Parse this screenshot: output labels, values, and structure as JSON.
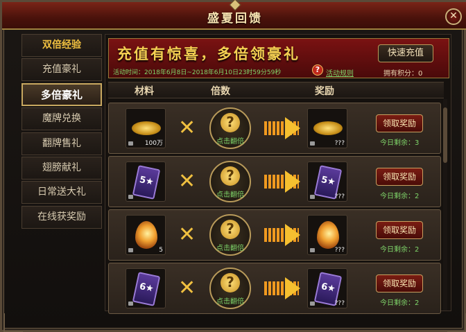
{
  "window": {
    "title": "盛夏回馈",
    "close_glyph": "✕"
  },
  "sidebar": {
    "items": [
      {
        "label": "双倍经验",
        "style": "gold"
      },
      {
        "label": "充值豪礼",
        "style": "normal"
      },
      {
        "label": "多倍豪礼",
        "style": "active"
      },
      {
        "label": "魔牌兑换",
        "style": "normal"
      },
      {
        "label": "翻牌售礼",
        "style": "normal"
      },
      {
        "label": "翅膀献礼",
        "style": "normal"
      },
      {
        "label": "日常送大礼",
        "style": "normal"
      },
      {
        "label": "在线获奖励",
        "style": "normal"
      }
    ]
  },
  "banner": {
    "title": "充值有惊喜，多倍领豪礼",
    "recharge_button": "快速充值",
    "activity_time": "活动时间：2018年6月8日~2018年6月10日23时59分59秒",
    "rules_link": "活动规则",
    "points": "拥有积分：0"
  },
  "table": {
    "headers": {
      "material": "材料",
      "multiplier": "倍数",
      "reward": "奖励"
    },
    "rows": [
      {
        "icon": "gold-coins-icon",
        "material_count": "100万",
        "flip_label": "点击翻倍",
        "reward_count": "???",
        "claim_label": "领取奖励",
        "remaining": "今日剩余：3"
      },
      {
        "icon": "card-5-star-icon",
        "card_text": "5★",
        "material_count": "",
        "flip_label": "点击翻倍",
        "reward_count": "???",
        "claim_label": "领取奖励",
        "remaining": "今日剩余：2"
      },
      {
        "icon": "essence-drop-icon",
        "material_count": "5",
        "flip_label": "点击翻倍",
        "reward_count": "???",
        "claim_label": "领取奖励",
        "remaining": "今日剩余：2"
      },
      {
        "icon": "card-6-star-icon",
        "card_text": "6★",
        "material_count": "",
        "flip_label": "点击翻倍",
        "reward_count": "???",
        "claim_label": "领取奖励",
        "remaining": "今日剩余：2"
      }
    ],
    "times_glyph": "✕",
    "question_glyph": "?"
  },
  "colors": {
    "accent_gold": "#f0c040",
    "green_text": "#7fd66a",
    "banner_red": "#7a1212"
  }
}
